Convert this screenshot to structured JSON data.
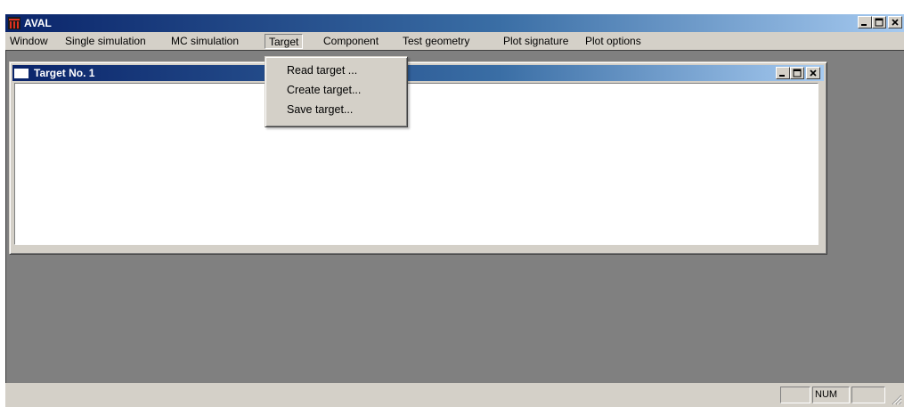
{
  "app": {
    "title": "AVAL"
  },
  "menubar": {
    "items": [
      {
        "label": "Window"
      },
      {
        "label": "Single simulation"
      },
      {
        "label": "MC simulation"
      },
      {
        "label": "Target"
      },
      {
        "label": "Component"
      },
      {
        "label": "Test geometry"
      },
      {
        "label": "Plot signature"
      },
      {
        "label": "Plot options"
      }
    ],
    "open_menu": "Target"
  },
  "target_menu": {
    "items": [
      {
        "label": "Read target ..."
      },
      {
        "label": "Create target..."
      },
      {
        "label": "Save target..."
      }
    ]
  },
  "child_window": {
    "title": "Target No. 1"
  },
  "statusbar": {
    "panels": [
      "",
      "NUM",
      ""
    ]
  },
  "colors": {
    "title_active_start": "#0a246a",
    "title_active_end": "#a6caf0",
    "face": "#d4d0c8",
    "mdi_background": "#808080"
  },
  "icons": [
    "app-logo-icon",
    "minimize-icon",
    "maximize-icon",
    "close-icon",
    "document-window-icon",
    "size-grip-icon"
  ]
}
